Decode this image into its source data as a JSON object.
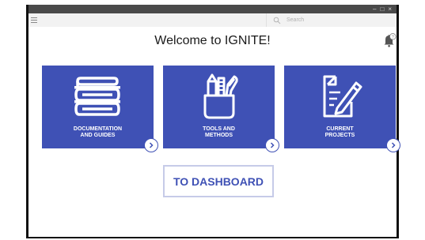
{
  "window": {
    "controls": [
      "–",
      "□",
      "×"
    ]
  },
  "toolbar": {
    "menu_icon": "hamburger-menu-icon",
    "search": {
      "icon": "search-icon",
      "placeholder": "Search"
    }
  },
  "header": {
    "title": "Welcome to IGNITE!",
    "notifications": {
      "icon": "bell-icon",
      "badge": "?"
    }
  },
  "cards": [
    {
      "label_line1": "DOCUMENTATION",
      "label_line2": "AND GUIDES",
      "icon": "books-icon"
    },
    {
      "label_line1": "TOOLS AND",
      "label_line2": "METHODS",
      "icon": "pencil-cup-icon"
    },
    {
      "label_line1": "CURRENT",
      "label_line2": "PROJECTS",
      "icon": "document-edit-icon"
    }
  ],
  "dashboard_button": {
    "label": "TO DASHBOARD"
  },
  "colors": {
    "accent": "#3f51b5",
    "titlebar": "#4a4a4a",
    "toolbar": "#f2f2f2"
  }
}
